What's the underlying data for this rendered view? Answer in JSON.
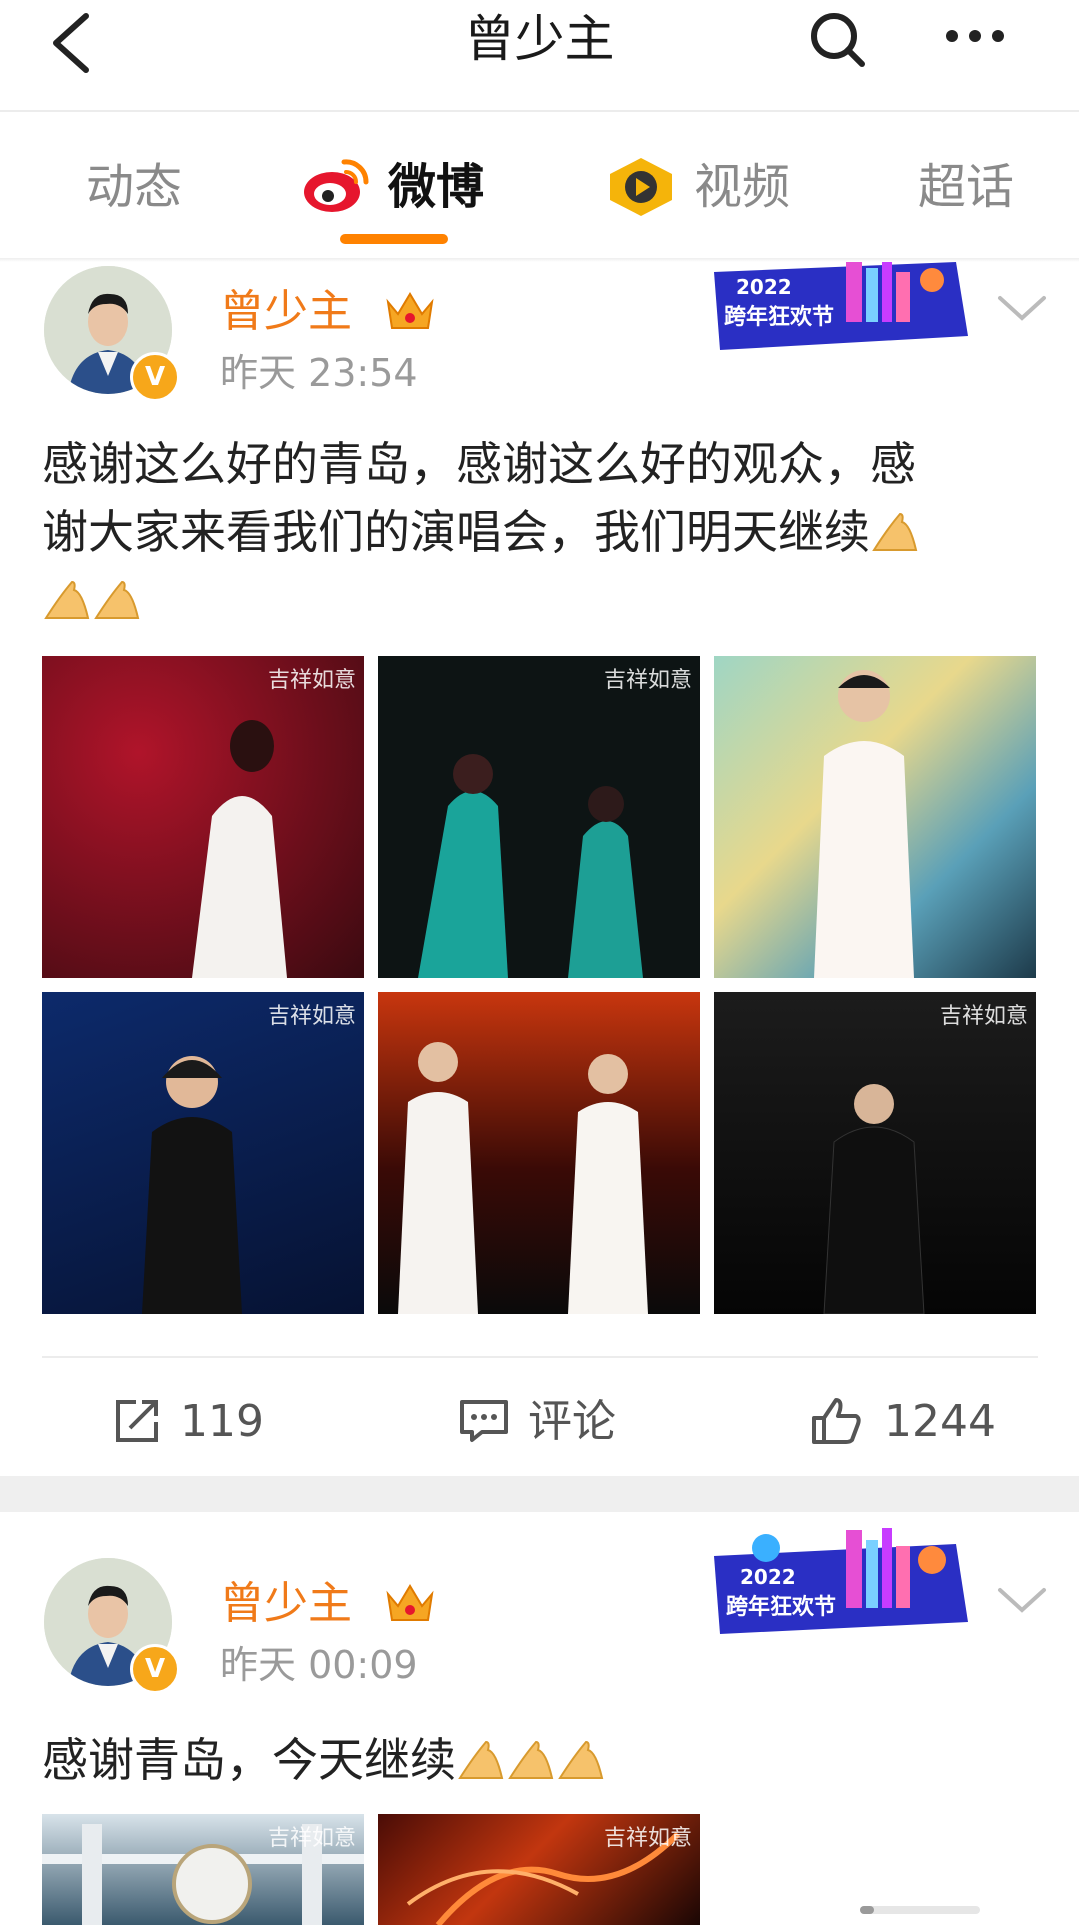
{
  "header": {
    "title": "曾少主",
    "back_icon": "chevron-left-icon",
    "search_icon": "search-icon",
    "more_icon": "more-horizontal-icon"
  },
  "tabs": [
    {
      "label": "动态",
      "active": false
    },
    {
      "label": "微博",
      "active": true,
      "icon": "weibo-logo-icon"
    },
    {
      "label": "视频",
      "active": false,
      "icon": "video-play-icon"
    },
    {
      "label": "超话",
      "active": false
    }
  ],
  "accent_color": "#ff8200",
  "posts": [
    {
      "author": "曾少主",
      "time": "昨天 23:54",
      "badge": "V",
      "text_line1": "感谢这么好的青岛，感谢这么好的观众，感",
      "text_line2": "谢大家来看我们的演唱会，我们明天继续",
      "emoji_count": 3,
      "watermark": "吉祥如意",
      "promo": {
        "year": "2022",
        "label": "跨年狂欢节"
      },
      "images": [
        {
          "subject": "singer-in-white-red-background"
        },
        {
          "subject": "two-singers-in-teal"
        },
        {
          "subject": "singer-in-white-suit"
        },
        {
          "subject": "singer-in-black-blue-background"
        },
        {
          "subject": "duet-in-white-red-stage"
        },
        {
          "subject": "singer-in-black-dark-stage"
        }
      ],
      "actions": {
        "repost": "119",
        "comment": "评论",
        "like": "1244"
      }
    },
    {
      "author": "曾少主",
      "time": "昨天 00:09",
      "badge": "V",
      "text": "感谢青岛，今天继续",
      "emoji_count": 3,
      "watermark": "吉祥如意",
      "promo": {
        "year": "2022",
        "label": "跨年狂欢节"
      }
    }
  ]
}
